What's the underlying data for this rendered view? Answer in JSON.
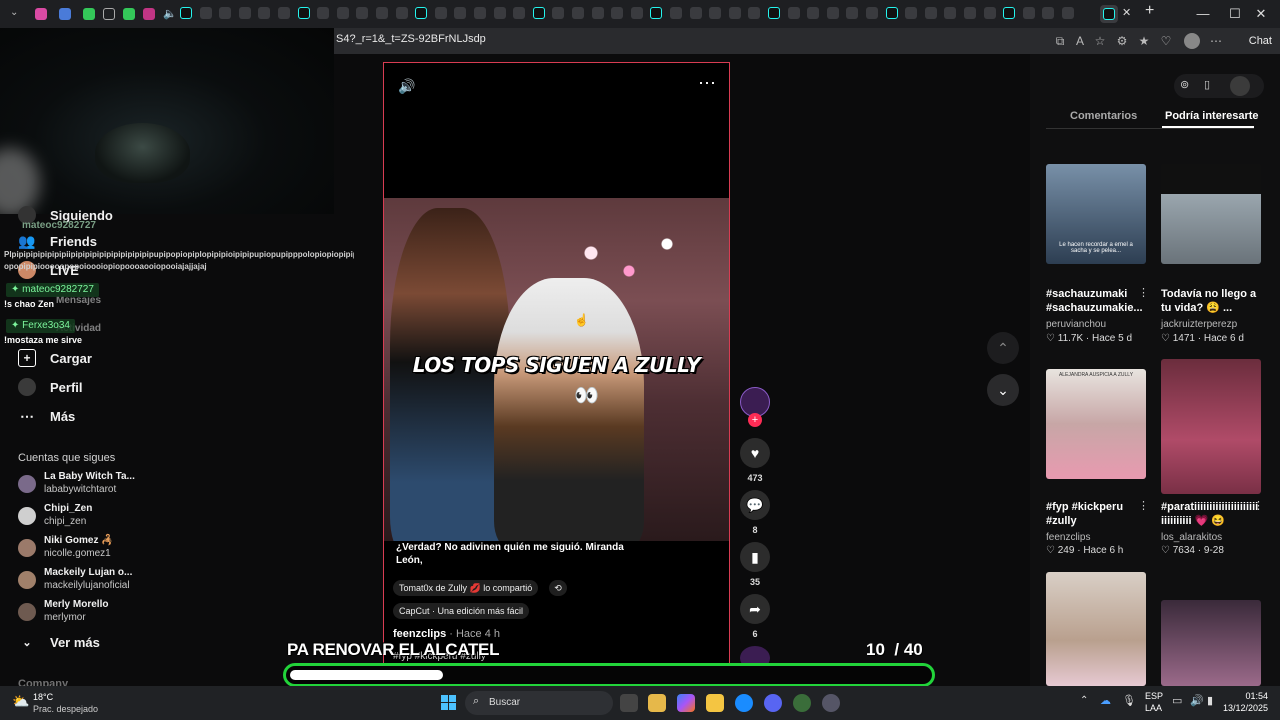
{
  "browser": {
    "url": "S4?_r=1&_t=ZS-92BFrNLJsdp",
    "chat_label": "Chat",
    "close": "✕",
    "minimize": "—",
    "maximize": "☐",
    "new_tab": "+"
  },
  "sidebar": {
    "items": [
      {
        "label": "Siguiendo",
        "icon": "following-icon"
      },
      {
        "label": "Friends",
        "icon": "friends-icon"
      },
      {
        "label": "LIVE",
        "icon": "live-icon"
      },
      {
        "label": "Mensajes",
        "icon": "messages-icon"
      },
      {
        "label": "Actividad",
        "icon": "activity-icon"
      },
      {
        "label": "Cargar",
        "icon": "upload-icon"
      },
      {
        "label": "Perfil",
        "icon": "profile-icon"
      },
      {
        "label": "Más",
        "icon": "more-icon"
      }
    ],
    "following_title": "Cuentas que sigues",
    "following": [
      {
        "name": "La Baby Witch Ta...",
        "handle": "lababywitchtarot"
      },
      {
        "name": "Chipi_Zen",
        "handle": "chipi_zen"
      },
      {
        "name": "Niki Gomez 🦂",
        "handle": "nicolle.gomez1"
      },
      {
        "name": "Mackeily Lujan o...",
        "handle": "mackeilylujanoficial"
      },
      {
        "name": "Merly Morello",
        "handle": "merlymor"
      }
    ],
    "see_more": "Ver más",
    "company": "Company"
  },
  "stream_chat": {
    "line1_user": "mateoc9282727",
    "line1_text": "Plpipipipipipipipiipipipipipipipipipipipipupipopiopiplopipipioipipipupiopupipppolopiopiopipipiooo opopipipiooooopopoioooiopiopoooaooiopooiajajjajaj",
    "line2_user": "mateoc9282727",
    "line2_text": "!s chao Zen",
    "line3_user": "Ferxe3o34",
    "line3_text": "!mostaza me sirve"
  },
  "video": {
    "overlay_caption": "LOS TOPS SIGUEN A ZULLY",
    "description": "¿Verdad? No adivinen quién me siguió. Miranda León,",
    "shared_pill": "Tomat0x de Zully 💋 lo compartió",
    "capcut_pill": "CapCut · Una edición más fácil",
    "author": "feenzclips",
    "posted": "· Hace 4 h",
    "hashtags": "#fyp #kickperu #zully"
  },
  "actions": {
    "likes": "473",
    "comments": "8",
    "saves": "35",
    "shares": "6"
  },
  "rpanel": {
    "tabs": [
      "Comentarios",
      "Podría interesarte"
    ],
    "active_tab": 1,
    "cards": [
      {
        "title": "#sachauzumaki #sachauzumakie...",
        "user": "peruvianchou",
        "stats": "♡ 11.7K · Hace 5 d",
        "thumb_text": "Le hacen recordar a ernel a sacha y se pelea..."
      },
      {
        "title": "Todavía no llego a tu vida? 😩 ...",
        "user": "jackruizterperezp",
        "stats": "♡ 1471 · Hace 6 d",
        "thumb_text": ""
      },
      {
        "title": "#fyp #kickperu #zully",
        "user": "feenzclips",
        "stats": "♡ 249 · Hace 6 h",
        "thumb_text": "ALEJANDRA AUSPICIA A ZULLY"
      },
      {
        "title": "#paratiiiiiiiiiiiiiiiiiiiii iiiiiiiiii 💗 😆",
        "user": "los_alarakitos",
        "stats": "♡ 7634 · 9-28",
        "thumb_text": ""
      }
    ]
  },
  "overlay": {
    "text": "PA RENOVAR EL ALCATEL",
    "count_current": "10",
    "count_total": "/ 40",
    "progress": 0.24
  },
  "taskbar": {
    "weather_temp": "18°C",
    "weather_desc": "Prac. despejado",
    "search_label": "Buscar",
    "lang": "ESP",
    "region": "LAA",
    "time": "01:54",
    "date": "13/12/2025"
  },
  "colors": {
    "video_border": "#d83c52",
    "progress_border": "#22d43a",
    "like_red": "#fe2c55",
    "badge_green": "#7cf59c"
  }
}
